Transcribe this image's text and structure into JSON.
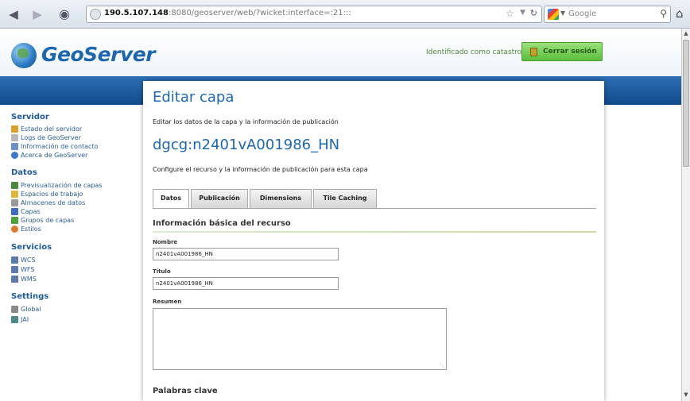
{
  "browser": {
    "url_host": "190.5.107.148",
    "url_rest": ":8080/geoserver/web/?wicket:interface=:21:::",
    "search_engine": "Google"
  },
  "header": {
    "logo_text": "GeoServer",
    "identified_text": "Identificado como catastro.",
    "logout_label": "Cerrar sesión"
  },
  "sidebar": {
    "sections": [
      {
        "title": "Servidor",
        "items": [
          {
            "label": "Estado del servidor",
            "icon": "server-status-icon",
            "color": "#d9a12c"
          },
          {
            "label": "Logs de GeoServer",
            "icon": "log-icon",
            "color": "#b8b8b8"
          },
          {
            "label": "Información de contacto",
            "icon": "contact-icon",
            "color": "#6b8fc8"
          },
          {
            "label": "Acerca de GeoServer",
            "icon": "about-icon",
            "color": "#3b79c9"
          }
        ]
      },
      {
        "title": "Datos",
        "items": [
          {
            "label": "Previsualización de capas",
            "icon": "layer-preview-icon",
            "color": "#4a8a3a"
          },
          {
            "label": "Espacios de trabajo",
            "icon": "workspace-icon",
            "color": "#e0b53a"
          },
          {
            "label": "Almacenes de datos",
            "icon": "datastore-icon",
            "color": "#9a9a9a"
          },
          {
            "label": "Capas",
            "icon": "layers-icon",
            "color": "#3d6cc0"
          },
          {
            "label": "Grupos de capas",
            "icon": "layer-groups-icon",
            "color": "#4da33a"
          },
          {
            "label": "Estilos",
            "icon": "styles-icon",
            "color": "#e07a2a"
          }
        ]
      },
      {
        "title": "Servicios",
        "items": [
          {
            "label": "WCS",
            "icon": "wcs-icon",
            "color": "#5a7ab0"
          },
          {
            "label": "WFS",
            "icon": "wfs-icon",
            "color": "#5a7ab0"
          },
          {
            "label": "WMS",
            "icon": "wms-icon",
            "color": "#5a7ab0"
          }
        ]
      },
      {
        "title": "Settings",
        "items": [
          {
            "label": "Global",
            "icon": "global-settings-icon",
            "color": "#8a8a8a"
          },
          {
            "label": "JAI",
            "icon": "jai-icon",
            "color": "#4a8a8a"
          }
        ]
      }
    ]
  },
  "main": {
    "title": "Editar capa",
    "subtitle": "Editar los datos de la capa y la información de publicación",
    "layer_name": "dgcg:n2401vA001986_HN",
    "layer_desc": "Configure el recurso y la información de publicación para esta capa",
    "tabs": [
      {
        "label": "Datos",
        "active": true
      },
      {
        "label": "Publicación",
        "active": false
      },
      {
        "label": "Dimensions",
        "active": false
      },
      {
        "label": "Tile Caching",
        "active": false
      }
    ],
    "section_title": "Información básica del recurso",
    "fields": {
      "name_label": "Nombre",
      "name_value": "n2401vA001986_HN",
      "title_label": "Título",
      "title_value": "n2401vA001986_HN",
      "abstract_label": "Resumen",
      "abstract_value": ""
    },
    "keywords_title": "Palabras clave"
  }
}
